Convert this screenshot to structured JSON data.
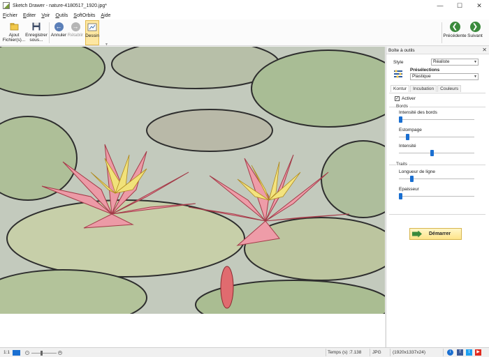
{
  "window": {
    "title": "Sketch Drawer - nature-4180517_1920.jpg*"
  },
  "menu": [
    "Fichier",
    "Editer",
    "Voir",
    "Outils",
    "SoftOrbits",
    "Aide"
  ],
  "toolbar": {
    "add_files_line1": "Ajout",
    "add_files_line2": "Fichier(s)...",
    "save_as_line1": "Enregistrer",
    "save_as_line2": "sous...",
    "undo": "Annuler",
    "redo": "Rétablir",
    "draw": "Dessin",
    "previous": "Précédente",
    "next": "Suivant"
  },
  "panel": {
    "title": "Boîte à outils",
    "style_label": "Style",
    "style_value": "Réaliste",
    "presets_label": "Présélections",
    "presets_value": "Plastique",
    "tabs": [
      "Kontur",
      "Incubation",
      "Couleurs"
    ],
    "activate_label": "Activer",
    "activate_checked": true,
    "edges_group": "Bords",
    "edges_intensity_label": "Intensité des bords",
    "blur_label": "Estompage",
    "intensity_label": "Intensité",
    "strokes_group": "Traits",
    "line_length_label": "Longueur de ligne",
    "thickness_label": "Epaisseur",
    "start_button": "Démarrer"
  },
  "status": {
    "zoom_label": "1:1",
    "time_label": "Temps (s) :7.138",
    "format": "JPG",
    "dimensions": "(1920x1337x24)"
  },
  "colors": {
    "accent_blue": "#1a6fd1",
    "nav_green": "#3a8a3c",
    "active_tool": "#fde7a2",
    "start_button": "#fde48a"
  },
  "icons": [
    "add-files-icon",
    "save-icon",
    "undo-icon",
    "redo-icon",
    "draw-icon",
    "previous-icon",
    "next-icon",
    "presets-icon",
    "start-arrow-icon",
    "info-icon",
    "facebook-icon",
    "twitter-icon",
    "youtube-icon"
  ]
}
